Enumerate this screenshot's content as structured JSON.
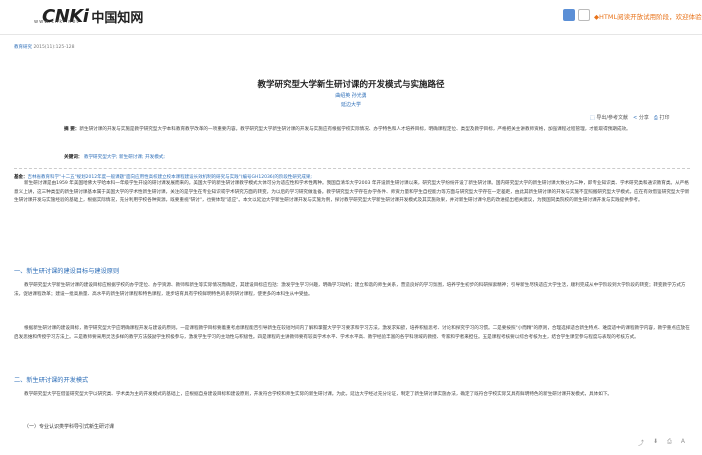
{
  "header": {
    "logo_mark": "CNKi",
    "logo_cn": "中国知网",
    "logo_sub": "www.cnki.net",
    "html_link": "◆HTML阅读开放试用阶段，欢迎体验！"
  },
  "breadcrumb": {
    "source": "教育研究",
    "issue": "2015(11):125-128"
  },
  "article": {
    "title": "教学研究型大学新生研讨课的开发模式与实施路径",
    "authors": "曲绍英  孙光勇",
    "org": "延边大学"
  },
  "tools": {
    "export": "导出/参考文献",
    "share": "分享",
    "print": "打印"
  },
  "abstract": {
    "label": "摘  要：",
    "text": "新生研讨课的开发与实施是教学研究型大学本科教育教学改革的一项重要内容。教学研究型大学新生研讨课的开发与实施应有根据学校实际情况、办学特色和人才培养目标，明确课程定位、类型及教学目标，严格把关主讲教师资格，加强课程过程管理，才能取得预期成效。"
  },
  "keywords": {
    "label": "关键词：",
    "items": "教学研究型大学; 新生研讨课; 开发模式;"
  },
  "fund": {
    "label": "基金：",
    "text": "吉林省教育科学\"十二五\"规划2012年度一般课题\"面向应用性高校建立校本课程建设长效机制的研究与实践\"(编号GH12036)的阶段性研究成果;"
  },
  "body": {
    "p1": "新生研讨课是由1959 年美国哈佛大学哈本科一年级学生开设的研讨课发展而来的。美国大学的新生研讨课教学模式大体可分为适应性和学术性两种。我国自清华大学2003 年开设新生研讨课以来，研究型大学纷纷开设了新生研讨课。国内研究型大学的新生研讨课大致分为三种，即专业知识类、学术研究类和通识教育类。从严格意义上讲，这三种类型的新生研讨课基本属于美国大学的学术性新生研讨课，关注的是学生在专业知识或学术研究方面的转变，为以后的学习研究做准备。教学研究型大学存在办学条件、师资力量和学生自控能力等方面与研究型大学存在一定差距，由此其新生研讨课的开发与实施不宜照搬研究型大学模式，应在有效借鉴研究型大学新生研讨课开发与实施经验的基础上，根据实际情况，充分利用学校各种资源，既要重视\"研讨\"，也要体现\"适应\"。本文以延边大学新生研讨课开发与实施为例，探讨教学研究型大学新生研讨课开发模式及其实施效果，并对新生研讨课今后的改进提出相关建议，为我国同类院校的新生研讨课开发与实践提供参考。",
    "s1": "一、新生研讨课的建设目标与建设原则",
    "p2": "教学研究型大学新生研讨课的建设目标应根据学校的办学定位、办学资源、教师和新生等实际情况而确定，其建设目标应包括：激发学生学习兴趣，明确学习动机；建立和谐的师生关系，营造良好的学习氛围，培养学生初步的科研探索精神；引导新生尽快适应大学生活，顺利完成从中学阶段到大学阶段的转变；转变教学方式方法，促进课程改革；建设一批高质量、高水平的新生研讨课程和特色课程，逐步培育具有学校鲜明特色的系列研讨课程，使更多的本科生从中受益。",
    "p3": "根据新生研讨课的建设目标，教学研究型大学应明确课程开发与建设的原则。一是课程教学目标要着重考虑课程能否引导新生在较短时间内了解和掌握大学学习要求和学习方法，激发求知欲，培养积极思考、讨论和探究学习的习惯。二是要按照\"小而精\"的原则，合理选择适合新生特点、难度适中的课程教学内容，教学重点应放在启发思维和传授学习方法上。三是教师要采用灵活多样的教学方法鼓励学生积极参与，激发学生学习的主动性与积极性。四是课程的主讲教师要有较高学术水平、学术水平高、教学经验丰富的各学科领域的教授、专家和学者来担任。五是课程考核要以综合考核为主，结合学生课堂参与程度与表现的考核方式。",
    "s2": "二、新生研讨课的开发模式",
    "p4": "教学研究型大学在借鉴研究型大学以研究类、学术类为主的开发模式的基础上，应根据自身建设目标和建设原则，开发符合学校和师生实际的新生研讨课。为此，延边大学经过充分论证，制定了新生研讨课实施办法，确定了既符合学校实际又具有鲜明特色的新生研讨课开发模式，具体如下。",
    "s3": "（一）专业认识类学科导引式新生研讨课"
  },
  "bottom_tools": [
    "share",
    "download",
    "print",
    "font"
  ]
}
